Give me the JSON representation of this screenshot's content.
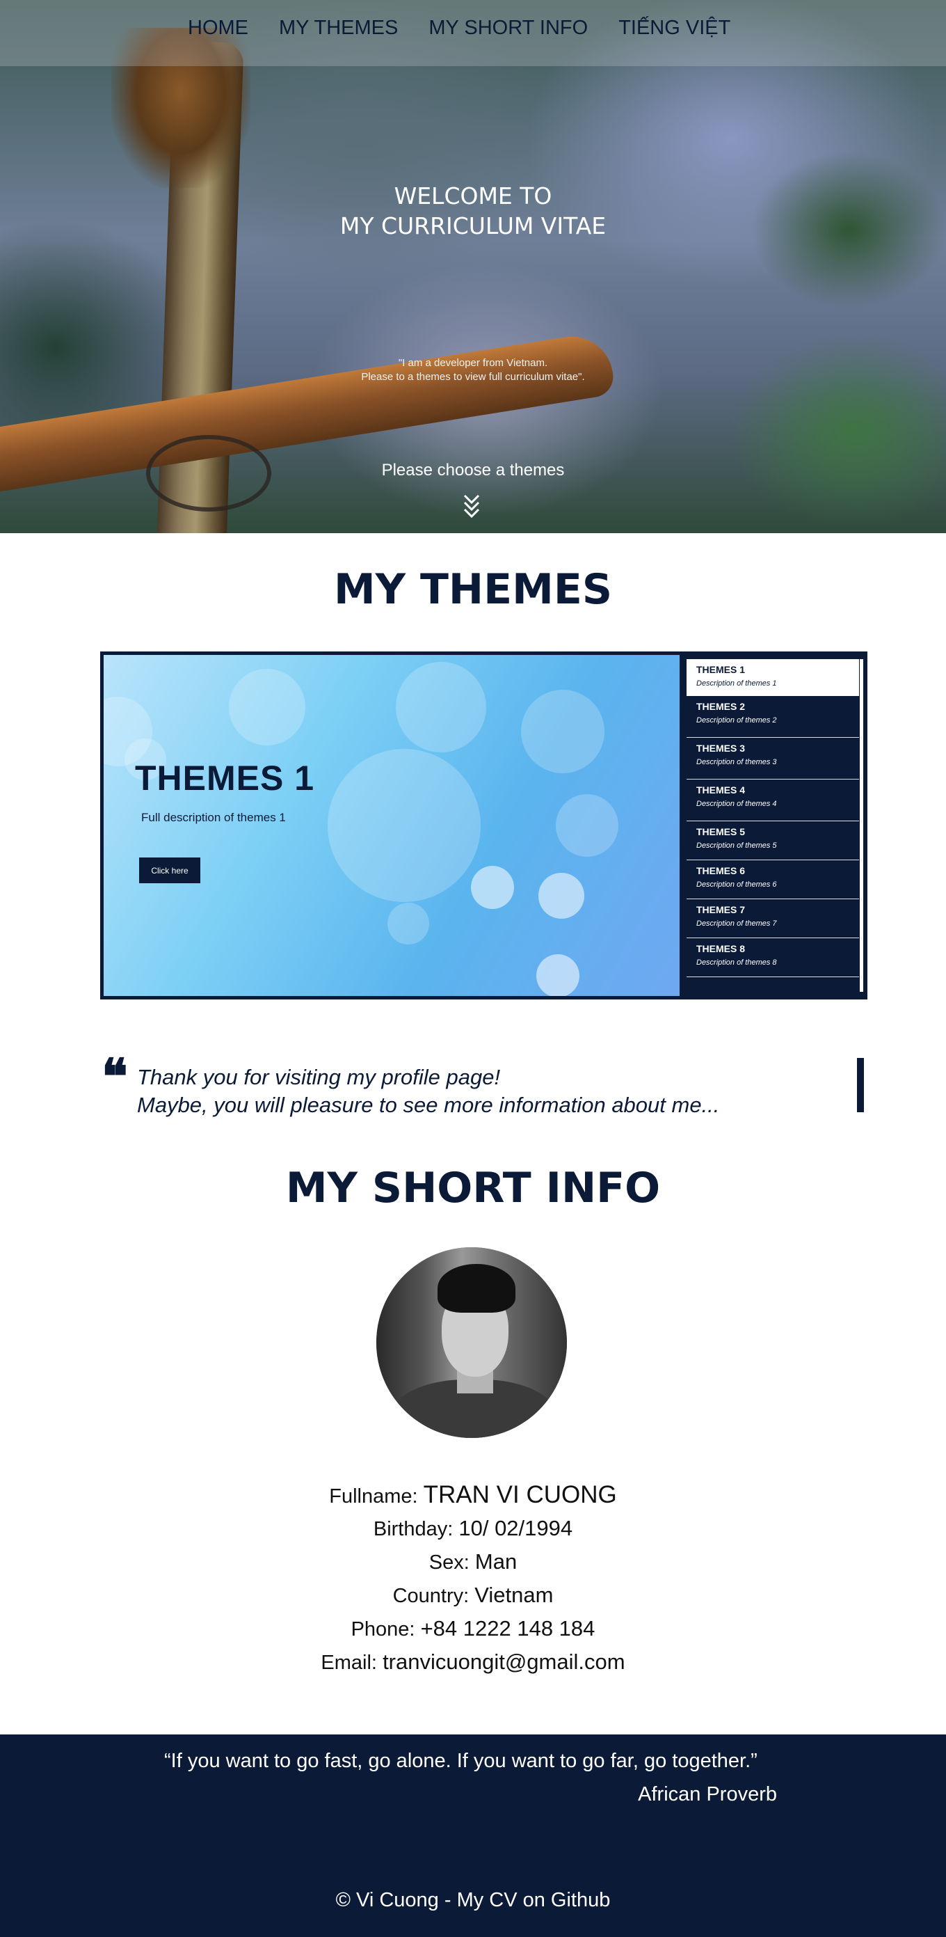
{
  "nav": {
    "items": [
      "HOME",
      "MY THEMES",
      "MY SHORT INFO",
      "TIẾNG VIỆT"
    ]
  },
  "hero": {
    "title_line1": "WELCOME TO",
    "title_line2": "MY CURRICULUM VITAE",
    "quote_line1": "\"I am a developer from Vietnam.",
    "quote_line2": "Please to a themes to view full curriculum vitae\".",
    "choose": "Please choose a themes",
    "arrow_icon": "double-chevron-down-icon"
  },
  "themes_section": {
    "title": "MY THEMES",
    "slide": {
      "title": "THEMES 1",
      "description": "Full description of themes 1",
      "button": "Click here"
    },
    "list": [
      {
        "title": "THEMES 1",
        "desc": "Description of themes 1"
      },
      {
        "title": "THEMES 2",
        "desc": "Description of themes 2"
      },
      {
        "title": "THEMES 3",
        "desc": "Description of themes 3"
      },
      {
        "title": "THEMES 4",
        "desc": "Description of themes 4"
      },
      {
        "title": "THEMES 5",
        "desc": "Description of themes 5"
      },
      {
        "title": "THEMES 6",
        "desc": "Description of themes 6"
      },
      {
        "title": "THEMES 7",
        "desc": "Description of themes 7"
      },
      {
        "title": "THEMES 8",
        "desc": "Description of themes 8"
      }
    ],
    "active_index": 0
  },
  "quote": {
    "mark": "❝",
    "line1": "Thank you for visiting my profile page!",
    "line2": "Maybe, you will pleasure to see  more information about me..."
  },
  "short_info": {
    "title": "MY SHORT INFO",
    "fullname_label": "Fullname: ",
    "fullname": "TRAN VI CUONG",
    "birthday_label": "Birthday: ",
    "birthday": "10/ 02/1994",
    "sex_label": "Sex: ",
    "sex": "Man",
    "country_label": "Country: ",
    "country": "Vietnam",
    "phone_label": "Phone: ",
    "phone": "+84 1222 148 184",
    "email_label": "Email: ",
    "email": "tranvicuongit@gmail.com"
  },
  "footer": {
    "quote": "“If you want to go fast, go alone. If you want to go far, go together.”",
    "author": "African Proverb",
    "copyright": "© Vi Cuong - My CV on Github"
  },
  "colors": {
    "navy": "#0b1a36",
    "white": "#ffffff"
  }
}
